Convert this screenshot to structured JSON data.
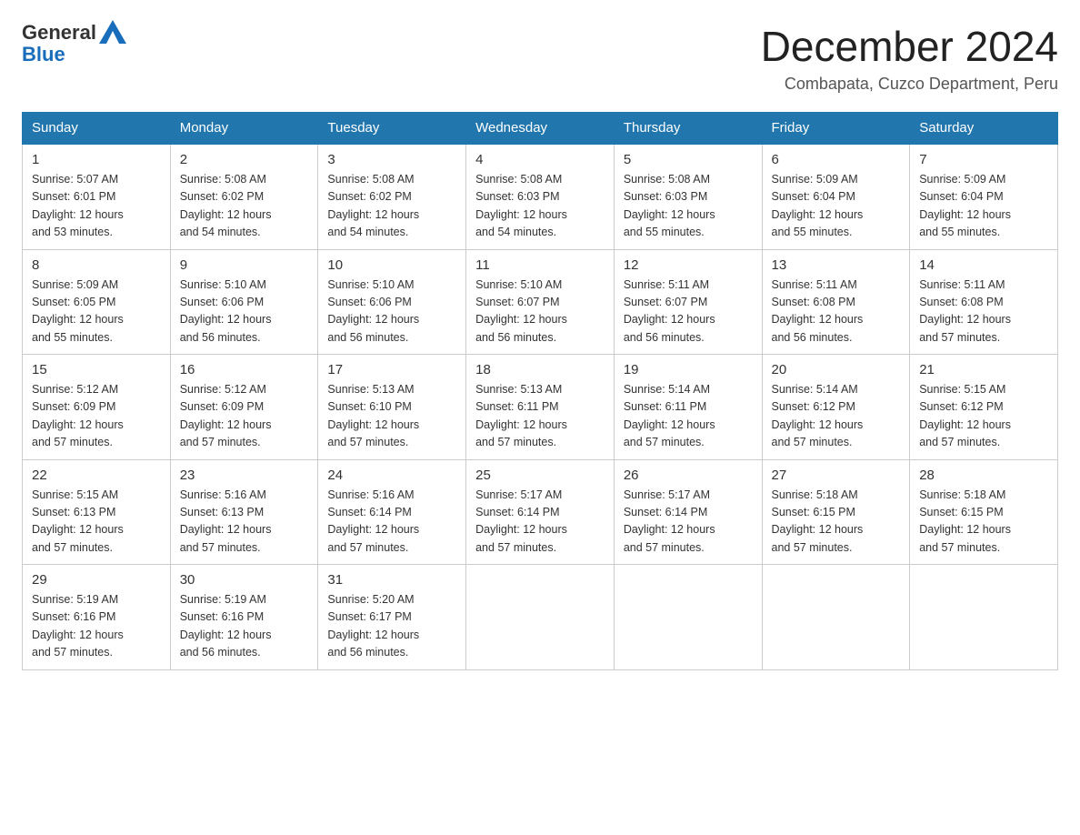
{
  "header": {
    "logo_general": "General",
    "logo_blue": "Blue",
    "month_title": "December 2024",
    "location": "Combapata, Cuzco Department, Peru"
  },
  "days_of_week": [
    "Sunday",
    "Monday",
    "Tuesday",
    "Wednesday",
    "Thursday",
    "Friday",
    "Saturday"
  ],
  "weeks": [
    [
      {
        "day": "1",
        "sunrise": "5:07 AM",
        "sunset": "6:01 PM",
        "daylight": "12 hours and 53 minutes."
      },
      {
        "day": "2",
        "sunrise": "5:08 AM",
        "sunset": "6:02 PM",
        "daylight": "12 hours and 54 minutes."
      },
      {
        "day": "3",
        "sunrise": "5:08 AM",
        "sunset": "6:02 PM",
        "daylight": "12 hours and 54 minutes."
      },
      {
        "day": "4",
        "sunrise": "5:08 AM",
        "sunset": "6:03 PM",
        "daylight": "12 hours and 54 minutes."
      },
      {
        "day": "5",
        "sunrise": "5:08 AM",
        "sunset": "6:03 PM",
        "daylight": "12 hours and 55 minutes."
      },
      {
        "day": "6",
        "sunrise": "5:09 AM",
        "sunset": "6:04 PM",
        "daylight": "12 hours and 55 minutes."
      },
      {
        "day": "7",
        "sunrise": "5:09 AM",
        "sunset": "6:04 PM",
        "daylight": "12 hours and 55 minutes."
      }
    ],
    [
      {
        "day": "8",
        "sunrise": "5:09 AM",
        "sunset": "6:05 PM",
        "daylight": "12 hours and 55 minutes."
      },
      {
        "day": "9",
        "sunrise": "5:10 AM",
        "sunset": "6:06 PM",
        "daylight": "12 hours and 56 minutes."
      },
      {
        "day": "10",
        "sunrise": "5:10 AM",
        "sunset": "6:06 PM",
        "daylight": "12 hours and 56 minutes."
      },
      {
        "day": "11",
        "sunrise": "5:10 AM",
        "sunset": "6:07 PM",
        "daylight": "12 hours and 56 minutes."
      },
      {
        "day": "12",
        "sunrise": "5:11 AM",
        "sunset": "6:07 PM",
        "daylight": "12 hours and 56 minutes."
      },
      {
        "day": "13",
        "sunrise": "5:11 AM",
        "sunset": "6:08 PM",
        "daylight": "12 hours and 56 minutes."
      },
      {
        "day": "14",
        "sunrise": "5:11 AM",
        "sunset": "6:08 PM",
        "daylight": "12 hours and 57 minutes."
      }
    ],
    [
      {
        "day": "15",
        "sunrise": "5:12 AM",
        "sunset": "6:09 PM",
        "daylight": "12 hours and 57 minutes."
      },
      {
        "day": "16",
        "sunrise": "5:12 AM",
        "sunset": "6:09 PM",
        "daylight": "12 hours and 57 minutes."
      },
      {
        "day": "17",
        "sunrise": "5:13 AM",
        "sunset": "6:10 PM",
        "daylight": "12 hours and 57 minutes."
      },
      {
        "day": "18",
        "sunrise": "5:13 AM",
        "sunset": "6:11 PM",
        "daylight": "12 hours and 57 minutes."
      },
      {
        "day": "19",
        "sunrise": "5:14 AM",
        "sunset": "6:11 PM",
        "daylight": "12 hours and 57 minutes."
      },
      {
        "day": "20",
        "sunrise": "5:14 AM",
        "sunset": "6:12 PM",
        "daylight": "12 hours and 57 minutes."
      },
      {
        "day": "21",
        "sunrise": "5:15 AM",
        "sunset": "6:12 PM",
        "daylight": "12 hours and 57 minutes."
      }
    ],
    [
      {
        "day": "22",
        "sunrise": "5:15 AM",
        "sunset": "6:13 PM",
        "daylight": "12 hours and 57 minutes."
      },
      {
        "day": "23",
        "sunrise": "5:16 AM",
        "sunset": "6:13 PM",
        "daylight": "12 hours and 57 minutes."
      },
      {
        "day": "24",
        "sunrise": "5:16 AM",
        "sunset": "6:14 PM",
        "daylight": "12 hours and 57 minutes."
      },
      {
        "day": "25",
        "sunrise": "5:17 AM",
        "sunset": "6:14 PM",
        "daylight": "12 hours and 57 minutes."
      },
      {
        "day": "26",
        "sunrise": "5:17 AM",
        "sunset": "6:14 PM",
        "daylight": "12 hours and 57 minutes."
      },
      {
        "day": "27",
        "sunrise": "5:18 AM",
        "sunset": "6:15 PM",
        "daylight": "12 hours and 57 minutes."
      },
      {
        "day": "28",
        "sunrise": "5:18 AM",
        "sunset": "6:15 PM",
        "daylight": "12 hours and 57 minutes."
      }
    ],
    [
      {
        "day": "29",
        "sunrise": "5:19 AM",
        "sunset": "6:16 PM",
        "daylight": "12 hours and 57 minutes."
      },
      {
        "day": "30",
        "sunrise": "5:19 AM",
        "sunset": "6:16 PM",
        "daylight": "12 hours and 56 minutes."
      },
      {
        "day": "31",
        "sunrise": "5:20 AM",
        "sunset": "6:17 PM",
        "daylight": "12 hours and 56 minutes."
      },
      {
        "day": "",
        "sunrise": "",
        "sunset": "",
        "daylight": ""
      },
      {
        "day": "",
        "sunrise": "",
        "sunset": "",
        "daylight": ""
      },
      {
        "day": "",
        "sunrise": "",
        "sunset": "",
        "daylight": ""
      },
      {
        "day": "",
        "sunrise": "",
        "sunset": "",
        "daylight": ""
      }
    ]
  ]
}
